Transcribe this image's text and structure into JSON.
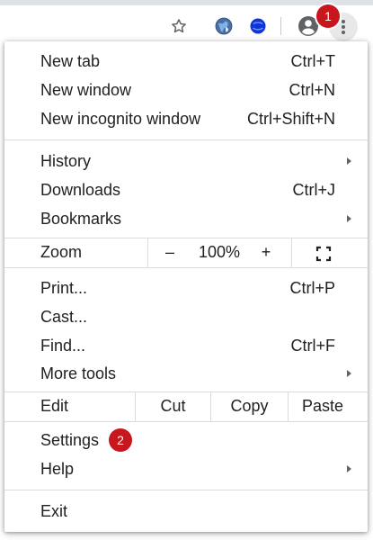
{
  "markers": {
    "first": "1",
    "second": "2"
  },
  "toolbar": {
    "icons": [
      "star-icon",
      "globe-extension-icon",
      "blue-extension-icon",
      "profile-icon",
      "more-vertical-icon"
    ]
  },
  "menu": {
    "new_tab": {
      "label": "New tab",
      "shortcut": "Ctrl+T"
    },
    "new_window": {
      "label": "New window",
      "shortcut": "Ctrl+N"
    },
    "new_incognito": {
      "label": "New incognito window",
      "shortcut": "Ctrl+Shift+N"
    },
    "history": {
      "label": "History"
    },
    "downloads": {
      "label": "Downloads",
      "shortcut": "Ctrl+J"
    },
    "bookmarks": {
      "label": "Bookmarks"
    },
    "zoom": {
      "label": "Zoom",
      "minus": "–",
      "value": "100%",
      "plus": "+"
    },
    "print": {
      "label": "Print...",
      "shortcut": "Ctrl+P"
    },
    "cast": {
      "label": "Cast..."
    },
    "find": {
      "label": "Find...",
      "shortcut": "Ctrl+F"
    },
    "more_tools": {
      "label": "More tools"
    },
    "edit": {
      "label": "Edit",
      "cut": "Cut",
      "copy": "Copy",
      "paste": "Paste"
    },
    "settings": {
      "label": "Settings"
    },
    "help": {
      "label": "Help"
    },
    "exit": {
      "label": "Exit"
    }
  },
  "colors": {
    "marker": "#c8161d",
    "separator": "#dadce0",
    "text": "#202124"
  }
}
